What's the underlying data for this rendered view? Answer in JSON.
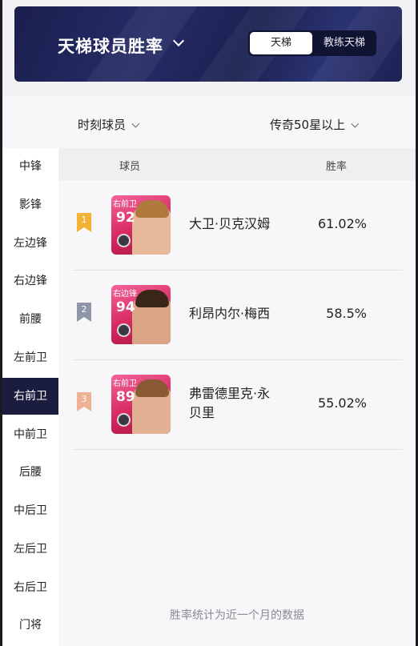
{
  "header": {
    "title": "天梯球员胜率",
    "mode_tabs": [
      "天梯",
      "教练天梯"
    ],
    "active_mode": "天梯"
  },
  "filters": {
    "player_type": "时刻球员",
    "tier": "传奇50星以上"
  },
  "sidebar": {
    "items": [
      "中锋",
      "影锋",
      "左边锋",
      "右边锋",
      "前腰",
      "左前卫",
      "右前卫",
      "中前卫",
      "后腰",
      "中后卫",
      "左后卫",
      "右后卫",
      "门将"
    ],
    "active": "右前卫"
  },
  "table": {
    "col_player": "球员",
    "col_winrate": "胜率",
    "rows": [
      {
        "rank": "1",
        "rank_color": "#f2b233",
        "card_position": "右前卫",
        "card_rating": "92",
        "name_line1": "大卫·贝克汉姆",
        "name_line2": "",
        "win_rate": "61.02%"
      },
      {
        "rank": "2",
        "rank_color": "#8e96a8",
        "card_position": "右边锋",
        "card_rating": "94",
        "name_line1": "利昂内尔·梅西",
        "name_line2": "",
        "win_rate": "58.5%"
      },
      {
        "rank": "3",
        "rank_color": "#eeb196",
        "card_position": "右前卫",
        "card_rating": "89",
        "name_line1": "弗雷德里克·永",
        "name_line2": "贝里",
        "win_rate": "55.02%"
      }
    ]
  },
  "footer_note": "胜率统计为近一个月的数据",
  "colors": {
    "banner": "#1f2558",
    "sidebar_active": "#1a1d3e",
    "card_pink": "#d6285f"
  }
}
